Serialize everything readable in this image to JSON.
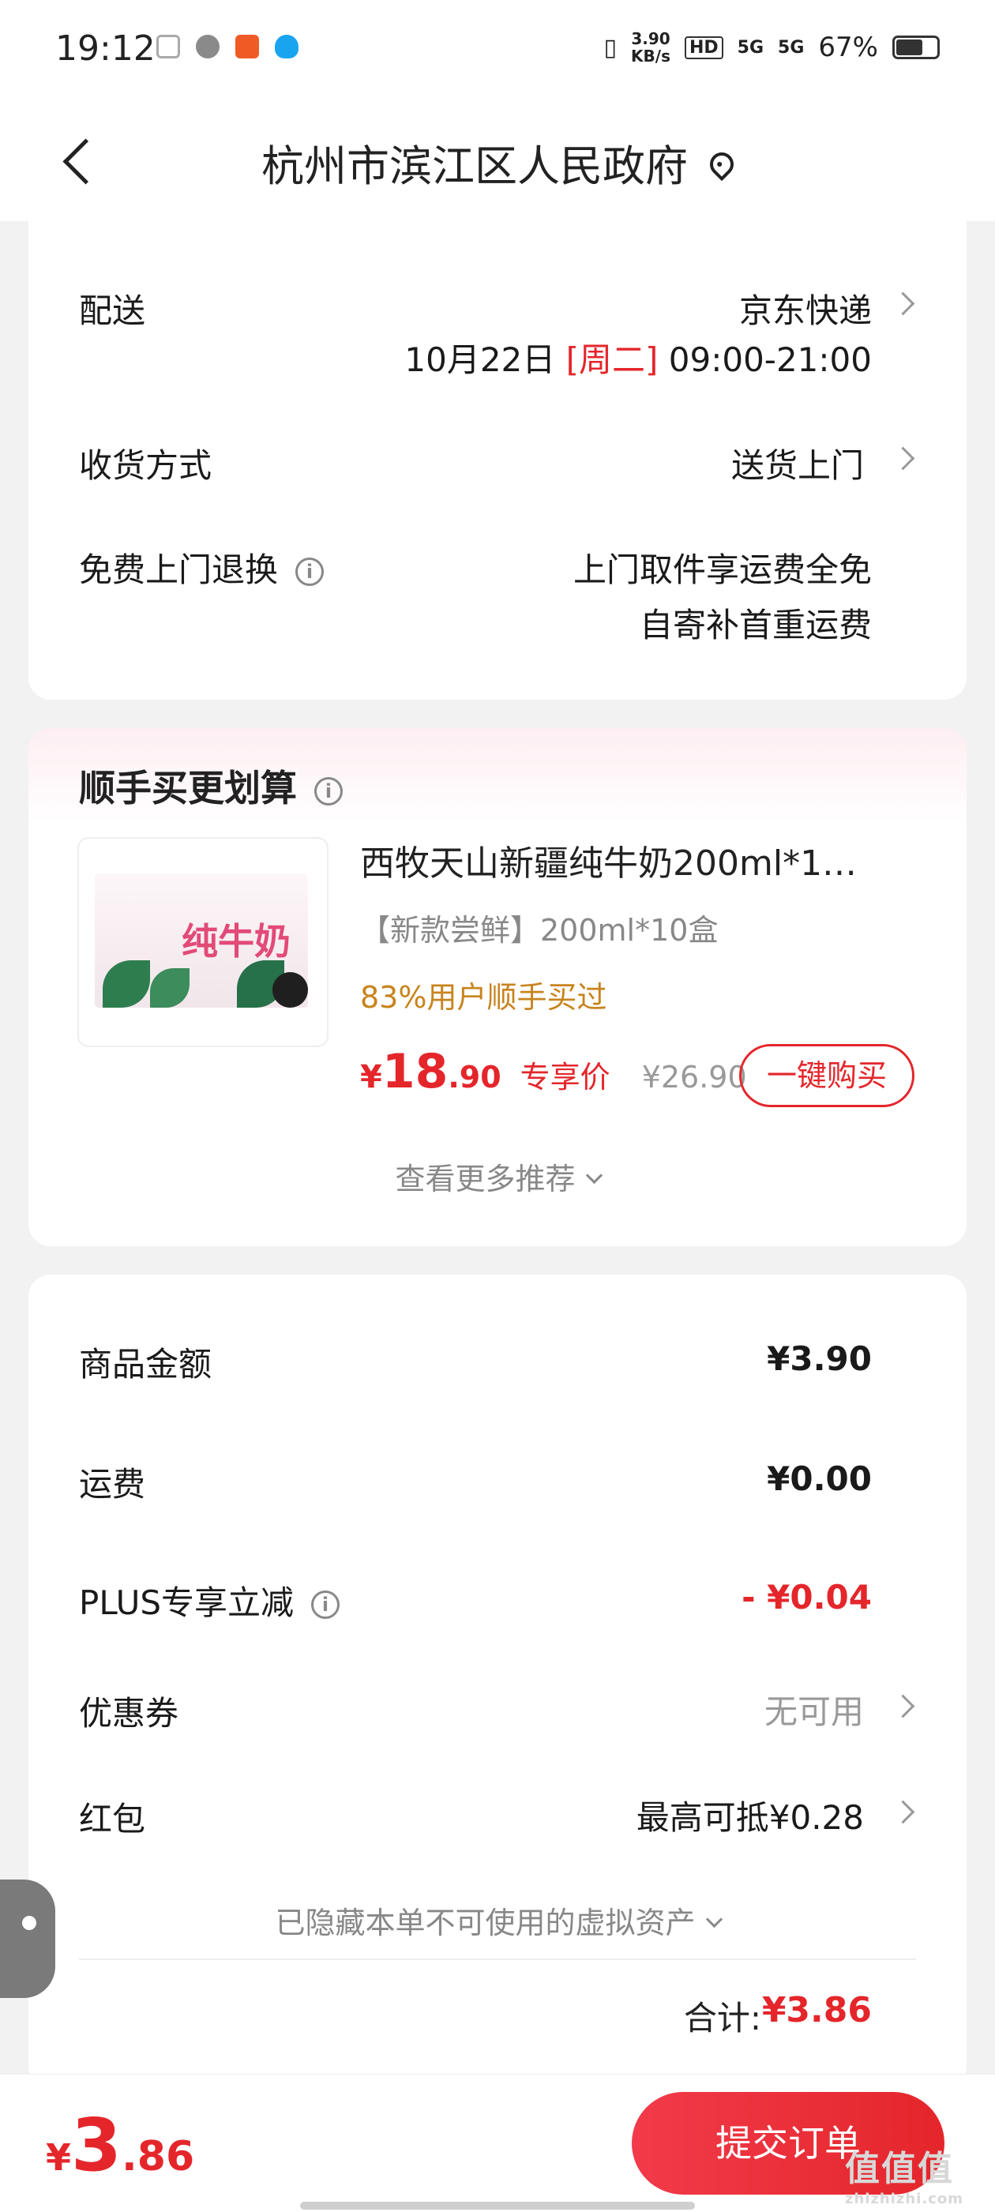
{
  "status_bar": {
    "time": "19:12",
    "speed_top": "3.90",
    "speed_unit": "KB/s",
    "net1": "HD",
    "net2": "5G",
    "net3": "5G",
    "battery": "67%",
    "battery_level": 0.67
  },
  "header": {
    "title": "杭州市滨江区人民政府"
  },
  "delivery": {
    "label": "配送",
    "carrier": "京东快递",
    "date": "10月22日",
    "weekday": "[周二]",
    "time_window": "09:00-21:00",
    "receive_label": "收货方式",
    "receive_value": "送货上门",
    "return_label": "免费上门退换",
    "return_line1": "上门取件享运费全免",
    "return_line2": "自寄补首重运费"
  },
  "recommend": {
    "title": "顺手买更划算",
    "product_name": "西牧天山新疆纯牛奶200ml*1…",
    "product_spec": "【新款尝鲜】200ml*10盒",
    "buyers": "83%用户顺手买过",
    "price_symbol": "¥",
    "price_int": "18",
    "price_dec": ".90",
    "price_tag": "专享价",
    "original_price": "¥26.90",
    "buy_button": "一键购买",
    "more": "查看更多推荐",
    "image_text": "纯牛奶"
  },
  "summary": {
    "goods_label": "商品金额",
    "goods_value": "¥3.90",
    "shipping_label": "运费",
    "shipping_value": "¥0.00",
    "plus_label": "PLUS专享立减",
    "plus_value": "- ¥0.04",
    "coupon_label": "优惠券",
    "coupon_value": "无可用",
    "redpack_label": "红包",
    "redpack_value": "最高可抵¥0.28",
    "hidden_assets": "已隐藏本单不可使用的虚拟资产",
    "total_label": "合计:",
    "total_value": "¥3.86"
  },
  "bottom": {
    "price_symbol": "¥",
    "price_int": "3",
    "price_dec": ".86",
    "submit": "提交订单",
    "watermark": "值值值",
    "watermark_url": "zhizhizhi.com"
  },
  "colors": {
    "accent_red": "#e4262b",
    "orange": "#c8841e"
  }
}
